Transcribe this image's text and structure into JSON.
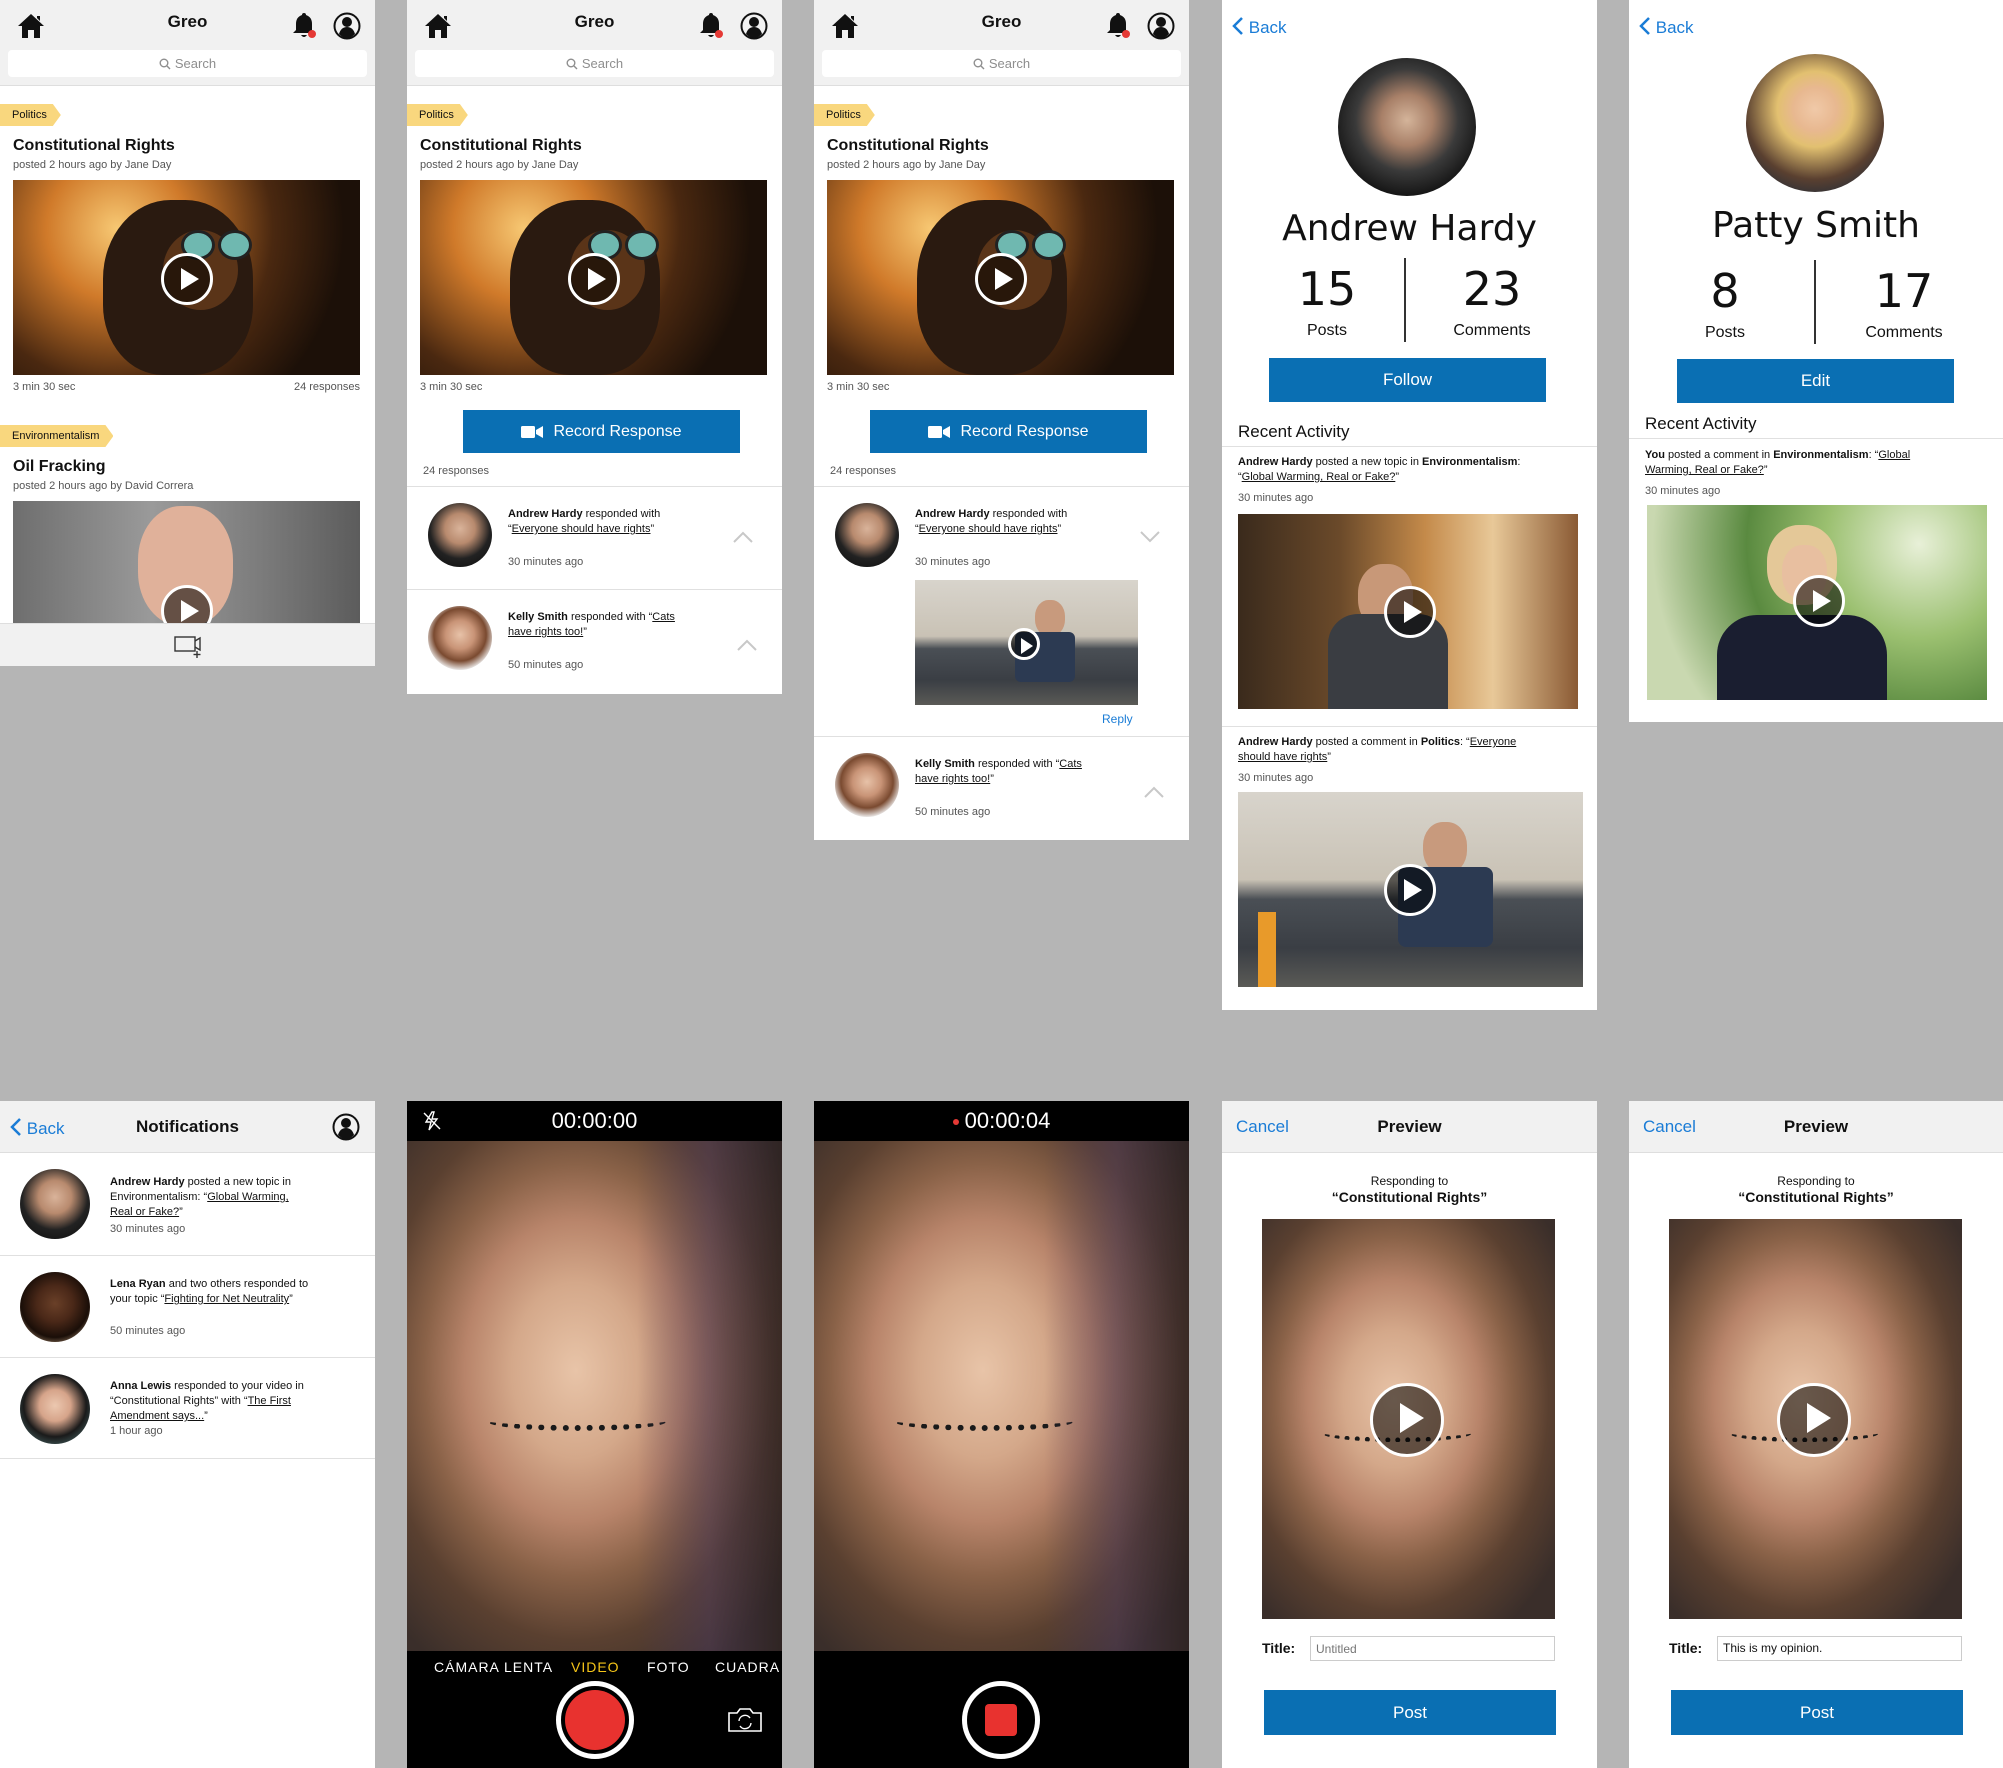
{
  "feed": {
    "app_title": "Greo",
    "search_placeholder": "Search",
    "post1": {
      "tag": "Politics",
      "title": "Constitutional Rights",
      "meta": "posted 2 hours ago by Jane Day",
      "duration": "3 min 30 sec",
      "responses": "24 responses"
    },
    "post2": {
      "tag": "Environmentalism",
      "title": "Oil Fracking",
      "meta": "posted 2 hours ago by David Correra"
    },
    "record_label": "Record Response",
    "responses_count": "24 responses",
    "reply_label": "Reply",
    "response1": {
      "name": "Andrew Hardy",
      "mid": " responded with",
      "quote": "Everyone should have rights",
      "time": "30 minutes ago"
    },
    "response2": {
      "name": "Kelly Smith",
      "mid": " responded with “",
      "quote1": "Cats",
      "quote2": "have rights too!",
      "time": "50 minutes ago"
    }
  },
  "profile_andrew": {
    "back": "Back",
    "name": "Andrew Hardy",
    "posts": "15",
    "posts_label": "Posts",
    "comments": "23",
    "comments_label": "Comments",
    "button": "Follow",
    "recent": "Recent Activity",
    "act1": {
      "name": "Andrew Hardy",
      "mid": " posted a new topic in ",
      "topic": "Environmentalism",
      "q1": "Global Warming, Real or Fake?",
      "time": "30 minutes ago"
    },
    "act2": {
      "name": "Andrew Hardy",
      "mid": " posted a comment in ",
      "topic": "Politics",
      "q1": "Everyone",
      "q2": "should have rights",
      "time": "30 minutes ago"
    }
  },
  "profile_patty": {
    "back": "Back",
    "name": "Patty Smith",
    "posts": "8",
    "posts_label": "Posts",
    "comments": "17",
    "comments_label": "Comments",
    "button": "Edit",
    "recent": "Recent Activity",
    "act1": {
      "name": "You",
      "mid": " posted a comment in ",
      "topic": "Environmentalism",
      "q1": "Global",
      "q2": "Warming, Real or Fake?",
      "time": "30 minutes ago"
    }
  },
  "notifications": {
    "back": "Back",
    "title": "Notifications",
    "items": [
      {
        "name": "Andrew Hardy",
        "text": " posted a new topic in",
        "line2": "Environmentalism: “",
        "link": "Global Warming,",
        "link2": "Real or Fake?",
        "time": "30 minutes ago"
      },
      {
        "name": "Lena Ryan",
        "text": " and two others responded to",
        "line2": "your topic “",
        "link": "Fighting for Net Neutrality",
        "time": "50 minutes ago"
      },
      {
        "name": "Anna Lewis",
        "text": " responded to your video in",
        "line2": "“Constitutional Rights” with “",
        "link": "The First",
        "link2": "Amendment says...",
        "time": "1 hour ago"
      }
    ]
  },
  "camera": {
    "timer1": "00:00:00",
    "timer2": "00:00:04",
    "modes": [
      "CÁMARA LENTA",
      "VIDEO",
      "FOTO",
      "CUADRA"
    ]
  },
  "preview": {
    "cancel": "Cancel",
    "title": "Preview",
    "responding": "Responding to",
    "topic": "“Constitutional Rights”",
    "title_label": "Title:",
    "placeholder": "Untitled",
    "value": "This is my opinion.",
    "post": "Post"
  },
  "colors": {
    "accent": "#0a6fb3",
    "link": "#1a7cd6",
    "tag": "#f9d77e",
    "notif_dot": "#e53935",
    "record": "#e8322f",
    "mode_active": "#f5c518"
  }
}
